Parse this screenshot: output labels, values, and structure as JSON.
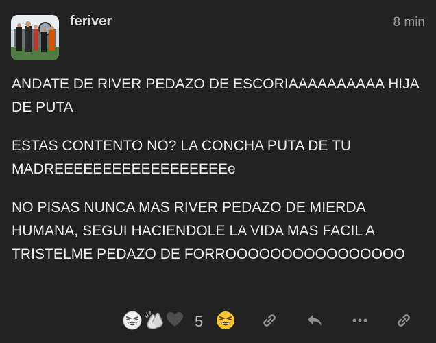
{
  "post": {
    "username": "feriver",
    "time": "8 min",
    "paragraphs": [
      "ANDATE DE RIVER PEDAZO DE ESCORIAAAAAAAAAA HIJA DE PUTA",
      "ESTAS CONTENTO NO? LA CONCHA PUTA DE TU MADREEEEEEEEEEEEEEEEEEe",
      "NO PISAS NUNCA MAS RIVER PEDAZO DE MIERDA HUMANA, SEGUI HACIENDOLE LA VIDA MAS FACIL A TRISTELME PEDAZO DE FORROOOOOOOOOOOOOOOO"
    ]
  },
  "actions": {
    "reaction_count": "5",
    "icons": [
      "grinning-squint-emoji",
      "clapping-hands-emoji",
      "heart-icon",
      "grinning-squint-emoji",
      "link-icon",
      "reply-icon",
      "more-icon",
      "link-icon"
    ]
  },
  "colors": {
    "background": "#222222",
    "text": "#ececec",
    "muted": "#9a9a9a",
    "icon": "#8f8f8f",
    "emoji_yellow": "#f7c637"
  }
}
